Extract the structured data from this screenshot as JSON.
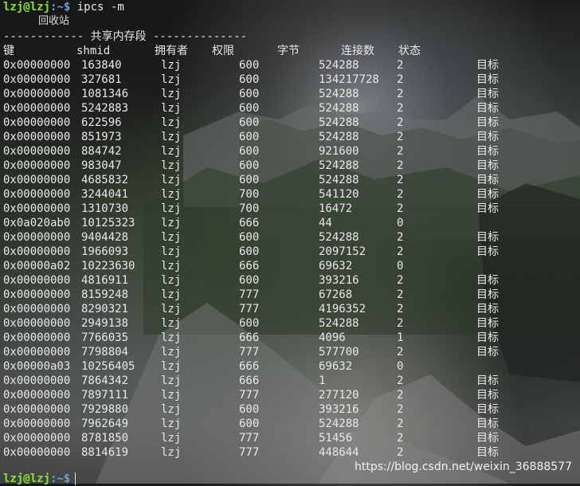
{
  "prompt": {
    "user": "lzj@lzj",
    "sep": ":~$",
    "command": "ipcs -m"
  },
  "ime_text": "回收站",
  "section_title": "------------ 共享内存段 --------------",
  "headers": [
    "键",
    "shmid",
    "拥有者",
    "权限",
    "字节",
    "连接数",
    "状态"
  ],
  "rows": [
    [
      "0x00000000",
      "163840",
      "lzj",
      "600",
      "524288",
      "2",
      "目标"
    ],
    [
      "0x00000000",
      "327681",
      "lzj",
      "600",
      "134217728",
      "2",
      "目标"
    ],
    [
      "0x00000000",
      "1081346",
      "lzj",
      "600",
      "524288",
      "2",
      "目标"
    ],
    [
      "0x00000000",
      "5242883",
      "lzj",
      "600",
      "524288",
      "2",
      "目标"
    ],
    [
      "0x00000000",
      "622596",
      "lzj",
      "600",
      "524288",
      "2",
      "目标"
    ],
    [
      "0x00000000",
      "851973",
      "lzj",
      "600",
      "524288",
      "2",
      "目标"
    ],
    [
      "0x00000000",
      "884742",
      "lzj",
      "600",
      "921600",
      "2",
      "目标"
    ],
    [
      "0x00000000",
      "983047",
      "lzj",
      "600",
      "524288",
      "2",
      "目标"
    ],
    [
      "0x00000000",
      "4685832",
      "lzj",
      "600",
      "524288",
      "2",
      "目标"
    ],
    [
      "0x00000000",
      "3244041",
      "lzj",
      "700",
      "541120",
      "2",
      "目标"
    ],
    [
      "0x00000000",
      "1310730",
      "lzj",
      "700",
      "16472",
      "2",
      "目标"
    ],
    [
      "0x0a020ab0",
      "10125323",
      "lzj",
      "666",
      "44",
      "0",
      ""
    ],
    [
      "0x00000000",
      "9404428",
      "lzj",
      "600",
      "524288",
      "2",
      "目标"
    ],
    [
      "0x00000000",
      "1966093",
      "lzj",
      "600",
      "2097152",
      "2",
      "目标"
    ],
    [
      "0x00000a02",
      "10223630",
      "lzj",
      "666",
      "69632",
      "0",
      ""
    ],
    [
      "0x00000000",
      "4816911",
      "lzj",
      "600",
      "393216",
      "2",
      "目标"
    ],
    [
      "0x00000000",
      "8159248",
      "lzj",
      "777",
      "67268",
      "2",
      "目标"
    ],
    [
      "0x00000000",
      "8290321",
      "lzj",
      "777",
      "4196352",
      "2",
      "目标"
    ],
    [
      "0x00000000",
      "2949138",
      "lzj",
      "600",
      "524288",
      "2",
      "目标"
    ],
    [
      "0x00000000",
      "7766035",
      "lzj",
      "666",
      "4096",
      "1",
      "目标"
    ],
    [
      "0x00000000",
      "7798804",
      "lzj",
      "777",
      "577700",
      "2",
      "目标"
    ],
    [
      "0x00000a03",
      "10256405",
      "lzj",
      "666",
      "69632",
      "0",
      ""
    ],
    [
      "0x00000000",
      "7864342",
      "lzj",
      "666",
      "1",
      "2",
      "目标"
    ],
    [
      "0x00000000",
      "7897111",
      "lzj",
      "777",
      "277120",
      "2",
      "目标"
    ],
    [
      "0x00000000",
      "7929880",
      "lzj",
      "600",
      "393216",
      "2",
      "目标"
    ],
    [
      "0x00000000",
      "7962649",
      "lzj",
      "600",
      "524288",
      "2",
      "目标"
    ],
    [
      "0x00000000",
      "8781850",
      "lzj",
      "777",
      "51456",
      "2",
      "目标"
    ],
    [
      "0x00000000",
      "8814619",
      "lzj",
      "777",
      "448644",
      "2",
      "目标"
    ]
  ],
  "watermark": "https://blog.csdn.net/weixin_36888577",
  "colors": {
    "prompt_user": "#8ae234",
    "prompt_path": "#729fcf",
    "text": "#e8e8e8"
  }
}
